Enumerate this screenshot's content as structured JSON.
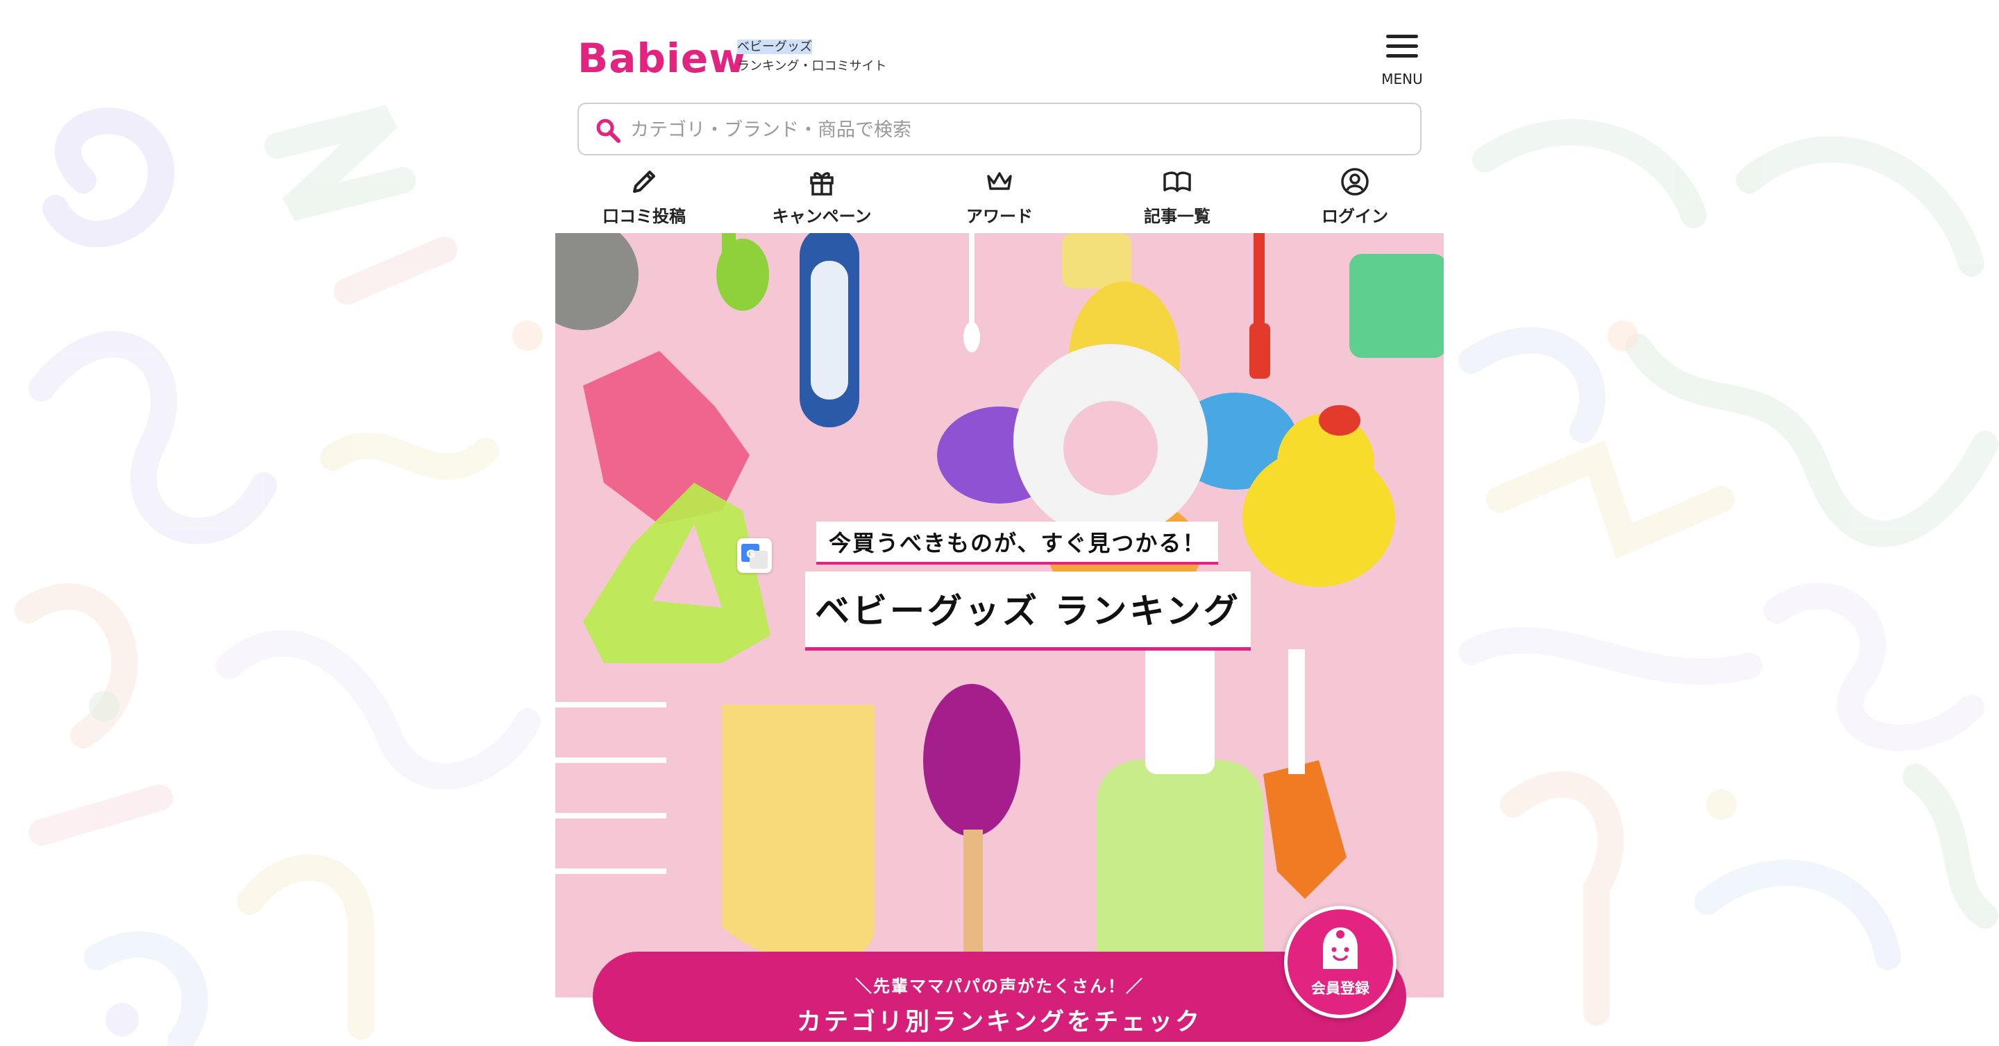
{
  "brand": {
    "logo": "Babiew",
    "tagline_line1": "ベビーグッズ",
    "tagline_line2": "ランキング・口コミサイト",
    "accent_color": "#e2237f"
  },
  "menu": {
    "label": "MENU",
    "icon": "hamburger-icon"
  },
  "search": {
    "placeholder": "カテゴリ・ブランド・商品で検索",
    "value": "",
    "icon": "search-icon"
  },
  "nav": [
    {
      "label": "口コミ投稿",
      "icon": "pencil-icon"
    },
    {
      "label": "キャンペーン",
      "icon": "gift-icon"
    },
    {
      "label": "アワード",
      "icon": "crown-icon"
    },
    {
      "label": "記事一覧",
      "icon": "book-icon"
    },
    {
      "label": "ログイン",
      "icon": "user-circle-icon"
    }
  ],
  "hero": {
    "subtitle": "今買うべきものが、すぐ見つかる！",
    "title": "ベビーグッズ ランキング"
  },
  "cta": {
    "small": "＼先輩ママパパの声がたくさん！／",
    "big": "カテゴリ別ランキングをチェック"
  },
  "member_button": {
    "label": "会員登録",
    "icon": "baby-face-icon"
  }
}
